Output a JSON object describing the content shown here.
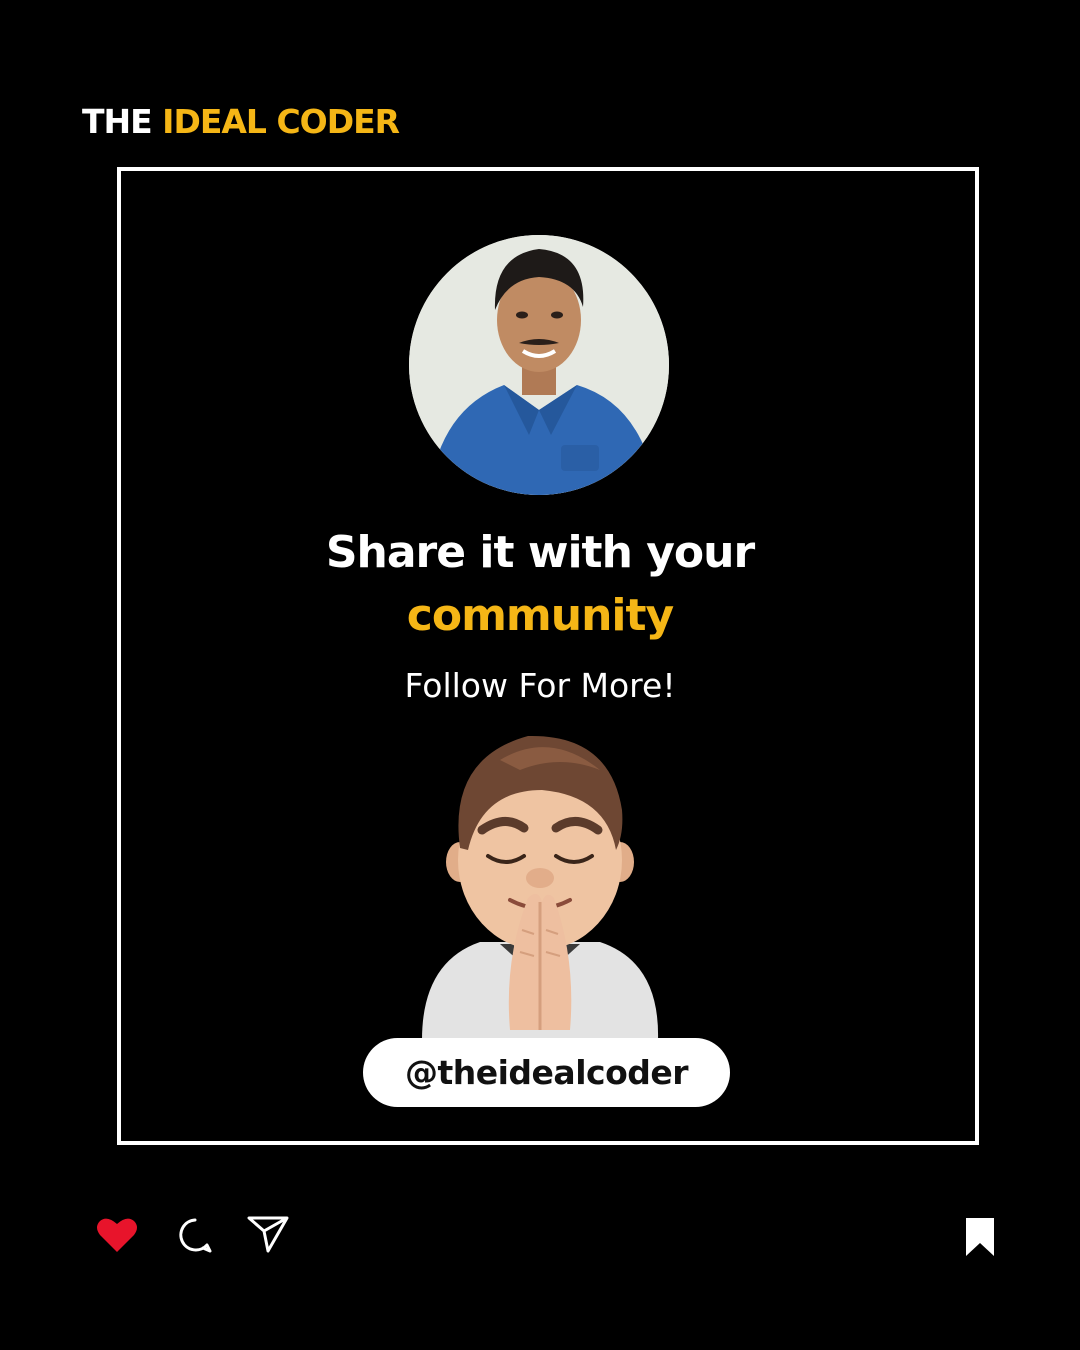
{
  "brand": {
    "part1": "THE",
    "part2": "IDEAL CODER"
  },
  "headline": {
    "line1": "Share it with your",
    "line2": "community"
  },
  "subtext": "Follow For More!",
  "handle": "@theidealcoder",
  "colors": {
    "accent": "#f5b616",
    "background": "#000000",
    "like": "#e8142b"
  },
  "actions": [
    "heart-icon",
    "comment-icon",
    "share-icon",
    "bookmark-icon"
  ]
}
